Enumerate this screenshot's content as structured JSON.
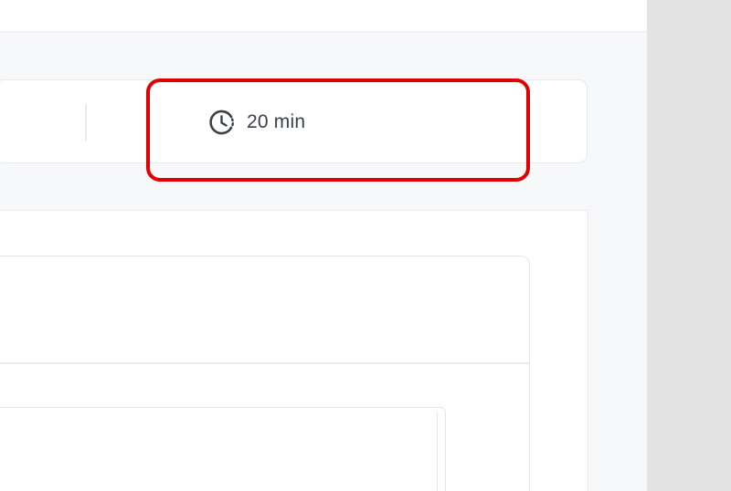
{
  "meta": {
    "duration": {
      "icon": "clock-icon",
      "label": "20 min"
    }
  },
  "colors": {
    "highlight": "#e00000",
    "text": "#3d4048",
    "gutter": "#e3e3e3",
    "panel": "#f7f8fa"
  }
}
